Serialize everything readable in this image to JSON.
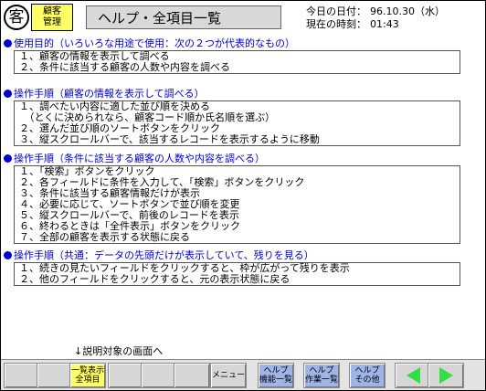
{
  "logo": {
    "kanji": "客",
    "line1": "顧客",
    "line2": "管理"
  },
  "title": "ヘルプ・全項目一覧",
  "date_label": "今日の日付：",
  "date_value": "96.10.30（水）",
  "time_label": "現在の時刻：",
  "time_value": "01:43",
  "sections": [
    {
      "heading": "使用目的（いろいろな用途で使用：次の２つが代表的なもの）",
      "steps": [
        "１、顧客の情報を表示して調べる",
        "２、条件に該当する顧客の人数や内容を調べる"
      ]
    },
    {
      "heading": "操作手順（顧客の情報を表示して調べる）",
      "steps": [
        "１、調べたい内容に適した並び順を決める",
        "　（とくに決められなら、顧客コード順か氏名順を選ぶ）",
        "２、選んだ並び順のソートボタンをクリック",
        "３、縦スクロールバーで、該当するレコードを表示するように移動"
      ]
    },
    {
      "heading": "操作手順（条件に該当する顧客の人数や内容を調べる）",
      "steps": [
        "１、「検索」ボタンをクリック",
        "２、各フィールドに条件を入力して、「検索」ボタンをクリック",
        "３、条件に該当する顧客情報だけが表示",
        "４、必要に応じて、ソートボタンで並び順を変更",
        "５、縦スクロールバーで、前後のレコードを表示",
        "６、終わるときは「全件表示」ボタンをクリック",
        "７、全部の顧客を表示する状態に戻る"
      ]
    },
    {
      "heading": "操作手順（共通：データの先頭だけが表示していて、残りを見る）",
      "steps": [
        "１、続きの見たいフィールドをクリックすると、枠が広がって残りを表示",
        "２、他のフィールドをクリックすると、元の表示状態に戻る"
      ]
    }
  ],
  "hint": "↓説明対象の画面へ",
  "footer": {
    "btn_all_items": [
      "一覧表示",
      "全項目"
    ],
    "btn_menu": "メニュー",
    "btn_help_functions": [
      "ヘルプ",
      "機能一覧"
    ],
    "btn_help_tasks": [
      "ヘルプ",
      "作業一覧"
    ],
    "btn_help_other": [
      "ヘルプ",
      "その他"
    ]
  },
  "colors": {
    "heading": "#0000cc",
    "highlight_button": "#ffff66",
    "help_button": "#9fb5e8",
    "nav_arrow": "#33dd44"
  },
  "icons": {
    "prev": "left-arrow-icon",
    "next": "right-arrow-icon"
  }
}
